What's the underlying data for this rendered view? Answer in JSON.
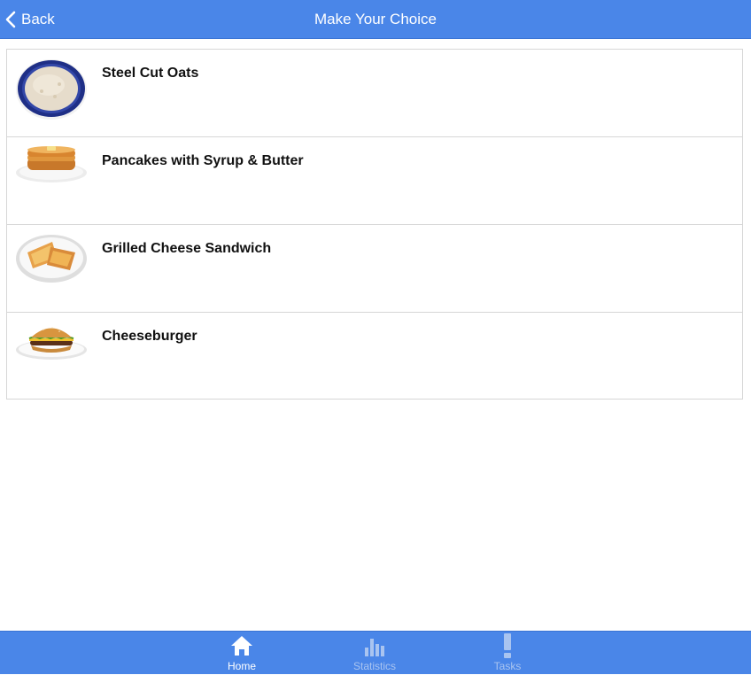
{
  "header": {
    "back_label": "Back",
    "title": "Make Your Choice"
  },
  "items": [
    {
      "label": "Steel Cut Oats",
      "image": "oatmeal-bowl"
    },
    {
      "label": "Pancakes with Syrup & Butter",
      "image": "pancakes-plate"
    },
    {
      "label": "Grilled Cheese Sandwich",
      "image": "grilled-cheese-plate"
    },
    {
      "label": "Cheeseburger",
      "image": "cheeseburger-plate"
    }
  ],
  "tabs": [
    {
      "label": "Home",
      "icon": "home-icon",
      "active": true
    },
    {
      "label": "Statistics",
      "icon": "bar-chart-icon",
      "active": false
    },
    {
      "label": "Tasks",
      "icon": "exclamation-icon",
      "active": false
    }
  ],
  "colors": {
    "accent": "#4a86e8",
    "inactive_tab_text": "#a9c4f0"
  }
}
